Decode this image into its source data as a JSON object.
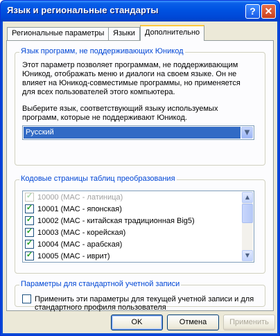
{
  "window": {
    "title": "Язык и региональные стандарты"
  },
  "titlebar": {
    "help_label": "?",
    "close_label": "✕"
  },
  "tabs": [
    {
      "label": "Региональные параметры",
      "active": false
    },
    {
      "label": "Языки",
      "active": false
    },
    {
      "label": "Дополнительно",
      "active": true
    }
  ],
  "nonunicode": {
    "legend": "Язык программ, не поддерживающих Юникод",
    "description_lines": [
      "Этот параметр позволяет программам, не поддерживающим",
      "Юникод, отображать меню и диалоги на своем языке. Он не",
      "влияет на Юникод-совместимые программы, но применяется",
      "для всех пользователей этого компьютера."
    ],
    "prompt_lines": [
      "Выберите язык, соответствующий языку используемых",
      "программ, которые не поддерживают Юникод."
    ],
    "selected_language": "Русский"
  },
  "codepages": {
    "legend": "Кодовые страницы таблиц преобразования",
    "items": [
      {
        "label": "10000 (MAC - латиница)",
        "checked": true,
        "disabled": true
      },
      {
        "label": "10001 (MAC - японская)",
        "checked": true,
        "disabled": false
      },
      {
        "label": "10002 (MAC - китайская традиционная Big5)",
        "checked": true,
        "disabled": false
      },
      {
        "label": "10003 (MAC - корейская)",
        "checked": true,
        "disabled": false
      },
      {
        "label": "10004 (MAC - арабская)",
        "checked": true,
        "disabled": false
      },
      {
        "label": "10005 (MAC - иврит)",
        "checked": true,
        "disabled": false
      }
    ]
  },
  "default_account": {
    "legend": "Параметры для стандартной учетной записи",
    "checkbox_lines": [
      "Применить эти параметры для текущей учетной записи и для",
      "стандартного профиля пользователя"
    ],
    "checked": false
  },
  "buttons": {
    "ok": "OK",
    "cancel": "Отмена",
    "apply": "Применить"
  }
}
